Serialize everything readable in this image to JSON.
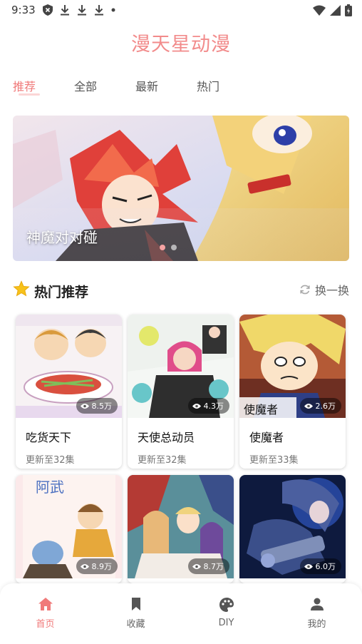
{
  "status_bar": {
    "time": "9:33"
  },
  "app": {
    "title": "漫天星动漫"
  },
  "tabs": [
    {
      "label": "推荐",
      "active": true
    },
    {
      "label": "全部",
      "active": false
    },
    {
      "label": "最新",
      "active": false
    },
    {
      "label": "热门",
      "active": false
    }
  ],
  "banner": {
    "caption": "神魔对对碰",
    "slide_count": 2,
    "active_slide": 0
  },
  "section": {
    "title": "热门推荐",
    "refresh_label": "换一换"
  },
  "comics": [
    {
      "name": "吃货天下",
      "update": "更新至32集",
      "views": "8.5万"
    },
    {
      "name": "天使总动员",
      "update": "更新至32集",
      "views": "4.3万"
    },
    {
      "name": "使魔者",
      "update": "更新至33集",
      "views": "2.6万"
    },
    {
      "name": "",
      "update": "",
      "views": "8.9万"
    },
    {
      "name": "",
      "update": "",
      "views": "8.7万"
    },
    {
      "name": "",
      "update": "",
      "views": "6.0万"
    }
  ],
  "cover_text": {
    "c3": "使魔者",
    "c4": "阿武"
  },
  "nav": [
    {
      "label": "首页",
      "icon": "home-icon",
      "active": true
    },
    {
      "label": "收藏",
      "icon": "bookmark-icon",
      "active": false
    },
    {
      "label": "DIY",
      "icon": "palette-icon",
      "active": false
    },
    {
      "label": "我的",
      "icon": "person-icon",
      "active": false
    }
  ],
  "colors": {
    "accent": "#f07a7a",
    "title": "#f28b8b",
    "star": "#f7c21a"
  }
}
